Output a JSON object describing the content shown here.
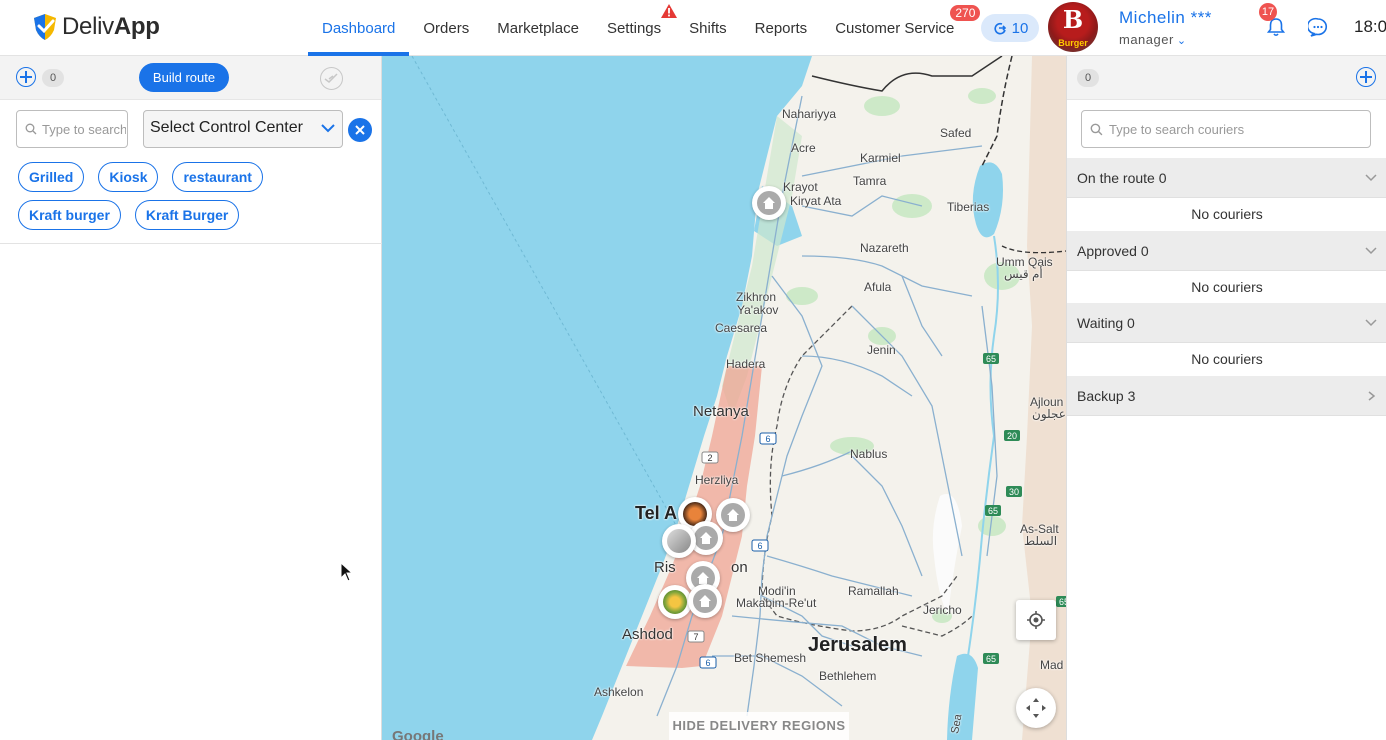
{
  "app": {
    "brand_prefix": "Deliv",
    "brand_suffix": "App",
    "brand_color": "#1a73e8",
    "logo_icon": "shield-check-icon"
  },
  "nav": {
    "items": [
      {
        "label": "Dashboard",
        "active": true
      },
      {
        "label": "Orders"
      },
      {
        "label": "Marketplace"
      },
      {
        "label": "Settings",
        "alert": "warning-icon"
      },
      {
        "label": "Shifts"
      },
      {
        "label": "Reports"
      },
      {
        "label": "Customer Service",
        "badge": "270"
      }
    ],
    "route_pill": "10",
    "route_pill_icon": "route-icon"
  },
  "user": {
    "avatar_letter": "B",
    "avatar_text": "Burger",
    "name": "Michelin ***",
    "role": "manager",
    "notifications": "17",
    "clock": "18:0"
  },
  "left_panel": {
    "count": "0",
    "build_route": "Build route",
    "search_placeholder": "Type to search",
    "control_center": "Select Control Center",
    "tags": [
      "Grilled",
      "Kiosk",
      "restaurant",
      "Kraft burger",
      "Kraft Burger"
    ]
  },
  "map": {
    "places": {
      "nahariyya": "Nahariyya",
      "acre": "Acre",
      "safed": "Safed",
      "karmiel": "Karmiel",
      "krayot": "Krayot",
      "kiryat_ata": "Kiryat Ata",
      "tamra": "Tamra",
      "tiberias": "Tiberias",
      "nazareth": "Nazareth",
      "umm_qais": "Umm Qais",
      "umm_qais_ar": "أم قيس",
      "afula": "Afula",
      "zikhron": "Zikhron",
      "yaakov": "Ya'akov",
      "caesarea": "Caesarea",
      "jenin": "Jenin",
      "hadera": "Hadera",
      "netanya": "Netanya",
      "ajloun": "Ajloun",
      "ajloun_ar": "عجلون",
      "nablus": "Nablus",
      "herzliya": "Herzliya",
      "tel_aviv": "Tel A",
      "as_salt": "As-Salt",
      "as_salt_ar": "السلط",
      "rishon": "Ris",
      "rishon_end": "on",
      "modiin": "Modi'in",
      "makabim": "Makabim-Re'ut",
      "ramallah": "Ramallah",
      "ashdod": "Ashdod",
      "jericho": "Jericho",
      "jerusalem": "Jerusalem",
      "madaba": "Mad",
      "bet_shemesh": "Bet Shemesh",
      "bethlehem": "Bethlehem",
      "ashkelon": "Ashkelon",
      "dead_sea": "Sea"
    },
    "road_shields": [
      "2",
      "6",
      "6",
      "7",
      "6",
      "65",
      "65",
      "20",
      "30",
      "65",
      "65"
    ],
    "hide_regions": "HIDE DELIVERY REGIONS",
    "google": "Google",
    "water_color": "#8fd4ec",
    "region_color": "#f0a08f"
  },
  "right_panel": {
    "count": "0",
    "search_placeholder": "Type to search couriers",
    "sections": [
      {
        "title": "On the route 0",
        "empty": "No couriers",
        "expanded": true
      },
      {
        "title": "Approved 0",
        "empty": "No couriers",
        "expanded": true
      },
      {
        "title": "Waiting 0",
        "empty": "No couriers",
        "expanded": true
      },
      {
        "title": "Backup 3",
        "expanded": false
      }
    ]
  }
}
